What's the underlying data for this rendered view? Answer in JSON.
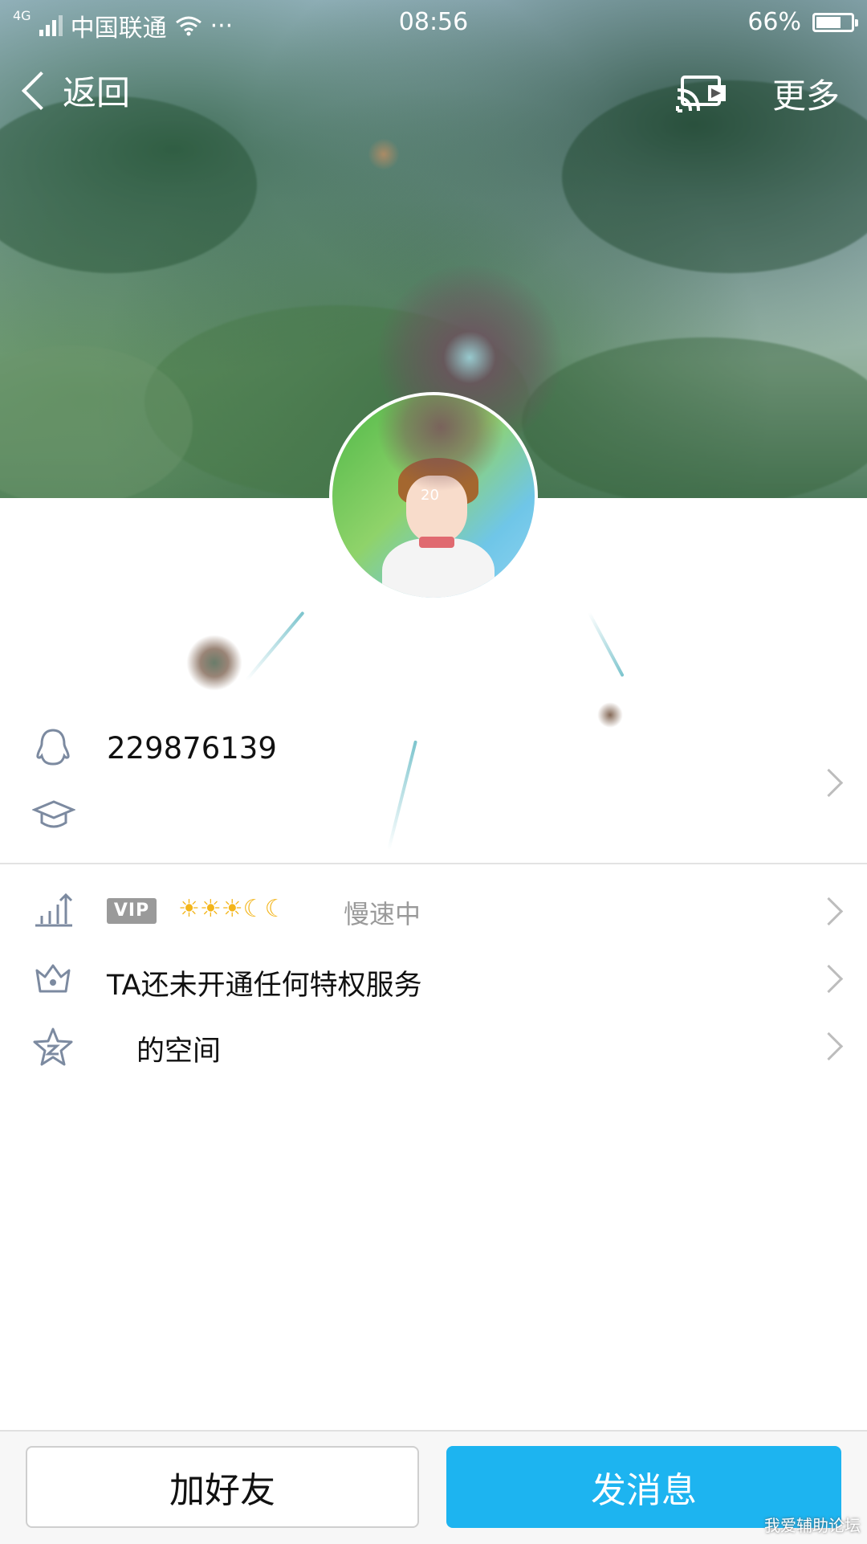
{
  "status_bar": {
    "network": "4G",
    "carrier": "中国联通",
    "dots": "···",
    "time": "08:56",
    "battery": "66%",
    "battery_level": 0.66
  },
  "nav": {
    "back_label": "返回",
    "more_label": "更多"
  },
  "profile": {
    "qq_number": "229876139",
    "avatar_badge": "20"
  },
  "rows": {
    "vip_badge": "VIP",
    "level_icons": "☀☀☀☾☾",
    "level_status": "慢速中",
    "privilege_text": "TA还未开通任何特权服务",
    "space_text": "的空间"
  },
  "actions": {
    "add_friend": "加好友",
    "send_message": "发消息"
  },
  "watermark": "我爱辅助论坛",
  "colors": {
    "accent": "#1db4f0",
    "text_primary": "#111111",
    "text_secondary": "#9a9a9a"
  }
}
